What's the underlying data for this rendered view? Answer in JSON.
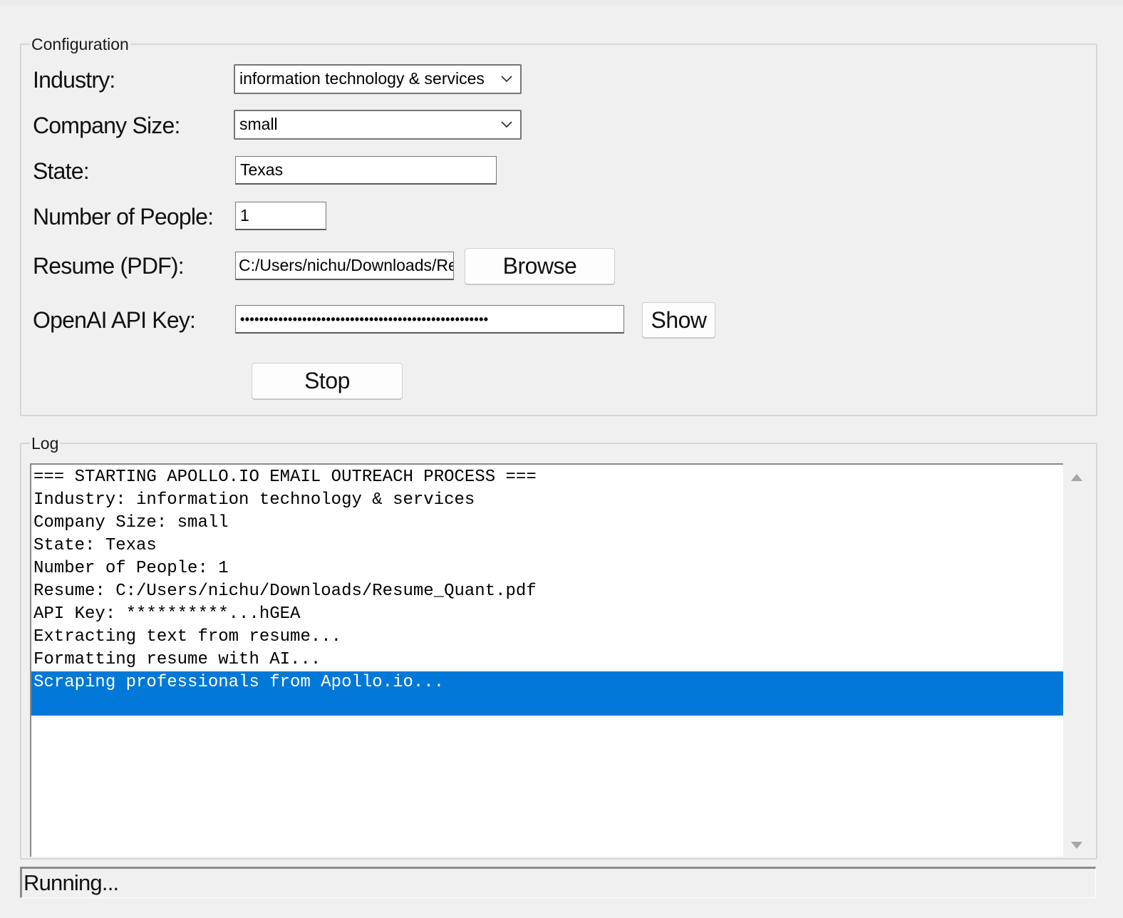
{
  "config": {
    "title": "Configuration",
    "industry_label": "Industry:",
    "industry_value": "information technology & services",
    "company_size_label": "Company Size:",
    "company_size_value": "small",
    "state_label": "State:",
    "state_value": "Texas",
    "num_people_label": "Number of People:",
    "num_people_value": "1",
    "resume_label": "Resume (PDF):",
    "resume_value": "C:/Users/nichu/Downloads/Resume_Quant.pdf",
    "browse_label": "Browse",
    "api_key_label": "OpenAI API Key:",
    "api_key_masked": "••••••••••••••••••••••••••••••••••••••••••••••••••••",
    "show_label": "Show",
    "stop_label": "Stop"
  },
  "log": {
    "title": "Log",
    "lines": [
      "=== STARTING APOLLO.IO EMAIL OUTREACH PROCESS ===",
      "Industry: information technology & services",
      "Company Size: small",
      "State: Texas",
      "Number of People: 1",
      "Resume: C:/Users/nichu/Downloads/Resume_Quant.pdf",
      "API Key: **********...hGEA",
      "Extracting text from resume...",
      "Formatting resume with AI...",
      "Scraping professionals from Apollo.io..."
    ],
    "selected_index": 9
  },
  "status": {
    "text": "Running..."
  },
  "colors": {
    "selection": "#0078d7",
    "window_bg": "#f0f0f0"
  },
  "icons": {
    "combo_arrow": "chevron-down-icon",
    "scroll_up": "scroll-up-arrow-icon",
    "scroll_down": "scroll-down-arrow-icon"
  }
}
